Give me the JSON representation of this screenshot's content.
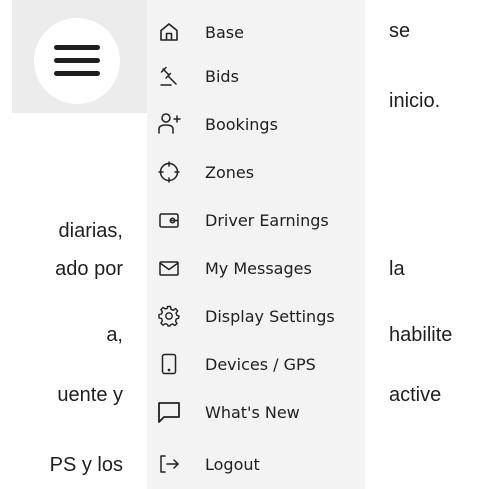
{
  "background_text": {
    "line_se": "se",
    "line_inicio": "inicio.",
    "line_diarias": "diarias,",
    "line_ado_por": "ado por",
    "line_la": "la",
    "line_a": "a,",
    "line_habilite": "habilite",
    "line_uente_y": "uente y",
    "line_active": "active",
    "line_ps_y_los": "PS y los"
  },
  "menu": {
    "items": [
      {
        "label": "Base",
        "icon": "home-icon"
      },
      {
        "label": "Bids",
        "icon": "gavel-icon"
      },
      {
        "label": "Bookings",
        "icon": "add-person-icon"
      },
      {
        "label": "Zones",
        "icon": "crosshair-icon"
      },
      {
        "label": "Driver Earnings",
        "icon": "wallet-icon"
      },
      {
        "label": "My Messages",
        "icon": "envelope-icon"
      },
      {
        "label": "Display Settings",
        "icon": "gear-icon"
      },
      {
        "label": "Devices / GPS",
        "icon": "phone-icon"
      },
      {
        "label": "What's New",
        "icon": "chat-bubble-icon"
      },
      {
        "label": "Logout",
        "icon": "logout-icon"
      }
    ]
  }
}
